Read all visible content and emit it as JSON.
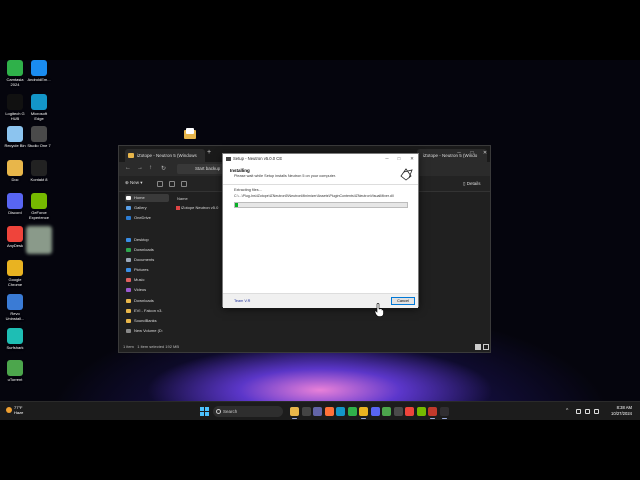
{
  "desktop": {
    "icons": [
      {
        "label": "Camtasia 2024",
        "color": "#2fb14a"
      },
      {
        "label": "AndroidEm...",
        "color": "#1a8cf0"
      },
      {
        "label": "Logitech G HUB",
        "color": "#111111"
      },
      {
        "label": "Microsoft Edge",
        "color": "#1396c8"
      },
      {
        "label": "Recycle Bin",
        "color": "#8cc4ef"
      },
      {
        "label": "Studio One 7",
        "color": "#4a4a4a"
      },
      {
        "label": "Doc",
        "color": "#e8b64a"
      },
      {
        "label": "Kontakt 8",
        "color": "#222222"
      },
      {
        "label": "Discord",
        "color": "#5865f2"
      },
      {
        "label": "GeForce Experience",
        "color": "#76b900"
      },
      {
        "label": "AnyDesk",
        "color": "#ef443b"
      },
      {
        "label": "",
        "color": "#8a9a8a"
      },
      {
        "label": "Google Chrome",
        "color": "#e9b321"
      },
      {
        "label": "Revo Uninstall...",
        "color": "#3a7bd5"
      },
      {
        "label": "Surfshark",
        "color": "#1ebeb4"
      },
      {
        "label": "uTorrent",
        "color": "#4ca64c"
      }
    ]
  },
  "explorer": {
    "tab_title": "iZotope - Neutron 5 (Windows",
    "tab2_title": "iZotope - Neutron 5 (Windo",
    "address": "Start backup",
    "new_label": "New",
    "details_label": "Details",
    "sidebar": [
      {
        "label": "Home",
        "color": "#ffffff"
      },
      {
        "label": "Gallery",
        "color": "#5aa0e8"
      },
      {
        "label": "OneDrive",
        "color": "#2b7cd3"
      },
      {
        "label": "Desktop",
        "color": "#3a8ee6"
      },
      {
        "label": "Downloads",
        "color": "#2fa84f"
      },
      {
        "label": "Documents",
        "color": "#9aa7b8"
      },
      {
        "label": "Pictures",
        "color": "#3a8ee6"
      },
      {
        "label": "Music",
        "color": "#e06060"
      },
      {
        "label": "Videos",
        "color": "#9b59d0"
      },
      {
        "label": "Downloads",
        "color": "#e8b64a"
      },
      {
        "label": "EVI - Falcon v3.",
        "color": "#e8b64a"
      },
      {
        "label": "SoundBanks",
        "color": "#e8b64a"
      },
      {
        "label": "New Volume (D:",
        "color": "#888888"
      }
    ],
    "column_header": "Name",
    "row_name": "iZotope Neutron v5.0",
    "status_count": "1 item",
    "status_selected": "1 item selected  192 MB"
  },
  "setup": {
    "title": "Setup - Neutron v5.0.0 CE",
    "heading": "Installing",
    "subheading": "Please wait while Setup installs Neutron 5 on your computer.",
    "extract_label": "Extracting files...",
    "extract_path": "C:\\...\\Plug-Ins\\iZotope\\iZNeutron5\\NeutronMinimizer\\Assets\\PluginContents\\iZNeutronVisualMixer.dll",
    "progress_fraction": 0.02,
    "brand": "Team V.R",
    "cancel_label": "Cancel"
  },
  "taskbar": {
    "weather_temp": "77°F",
    "weather_text": "Haze",
    "search_placeholder": "Search",
    "apps": [
      {
        "name": "file-explorer",
        "color": "#e8b64a",
        "running": true
      },
      {
        "name": "terminal",
        "color": "#444444",
        "running": false
      },
      {
        "name": "teams",
        "color": "#6264a7",
        "running": false
      },
      {
        "name": "firefox",
        "color": "#ff7139",
        "running": false
      },
      {
        "name": "edge",
        "color": "#1396c8",
        "running": false
      },
      {
        "name": "camtasia",
        "color": "#2fb14a",
        "running": false
      },
      {
        "name": "chrome",
        "color": "#e9b321",
        "running": true
      },
      {
        "name": "discord",
        "color": "#5865f2",
        "running": false
      },
      {
        "name": "utorrent",
        "color": "#4ca64c",
        "running": false
      },
      {
        "name": "studio-one",
        "color": "#4a4a4a",
        "running": false
      },
      {
        "name": "anydesk",
        "color": "#ef443b",
        "running": false
      },
      {
        "name": "geforce",
        "color": "#76b900",
        "running": false
      },
      {
        "name": "setup",
        "color": "#c0392b",
        "running": true
      },
      {
        "name": "obs",
        "color": "#302e31",
        "running": true
      }
    ],
    "time": "8:38 AM",
    "date": "10/27/2024"
  }
}
